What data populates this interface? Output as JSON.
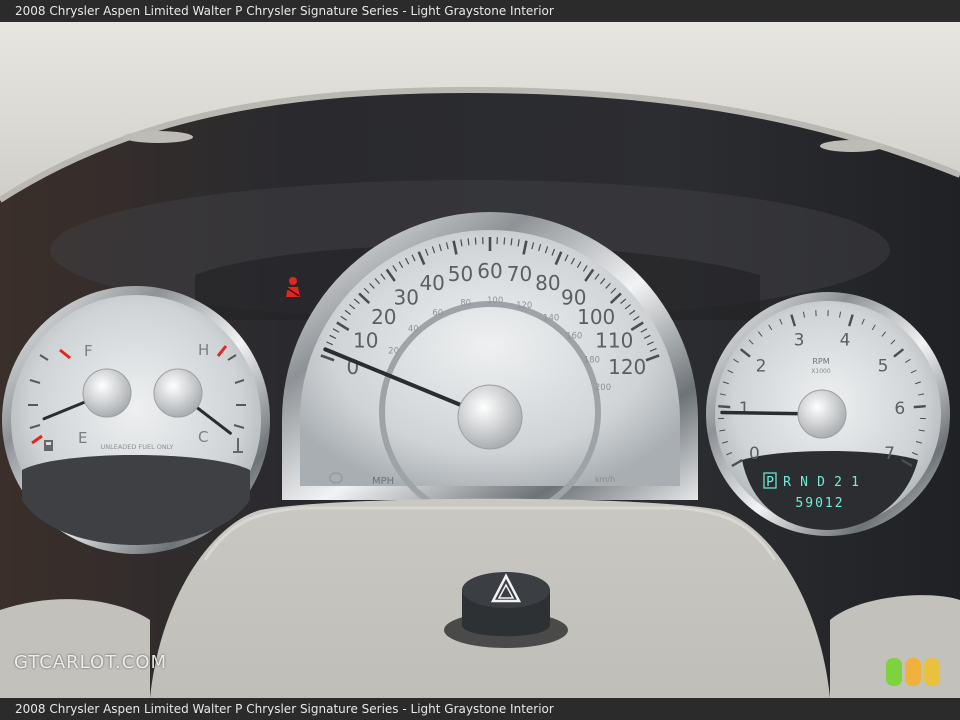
{
  "caption": {
    "top": "2008 Chrysler Aspen Limited Walter P Chrysler Signature Series - Light Graystone Interior",
    "bottom": "2008 Chrysler Aspen Limited Walter P Chrysler Signature Series - Light Graystone Interior"
  },
  "watermark": "GTCARLOT.COM",
  "rating_colors": [
    "#7ed23c",
    "#f0b23c",
    "#e8c23c"
  ],
  "speedometer": {
    "mph_labels": [
      "0",
      "10",
      "20",
      "30",
      "40",
      "50",
      "60",
      "70",
      "80",
      "90",
      "100",
      "110",
      "120"
    ],
    "kmh_labels": [
      "20",
      "40",
      "60",
      "80",
      "100",
      "120",
      "140",
      "160",
      "180",
      "200"
    ],
    "unit_mph": "MPH",
    "unit_kmh": "km/h",
    "reading_mph": 2
  },
  "tachometer": {
    "labels": [
      "0",
      "1",
      "2",
      "3",
      "4",
      "5",
      "6",
      "7"
    ],
    "unit": "RPM",
    "unit_sub": "X1000",
    "reading_krpm": 0.9
  },
  "fuel_temp_gauge": {
    "fuel_full": "F",
    "fuel_empty": "E",
    "temp_hot": "H",
    "temp_cold": "C",
    "fuel_note": "UNLEADED FUEL ONLY",
    "fuel_level": 0.05,
    "temp_level": 0.1
  },
  "gear_indicator": "PRND21",
  "selected_gear": "P",
  "odometer": "59012",
  "seatbelt_icon": "seatbelt-warning-icon",
  "hazard_icon": "hazard-triangle-icon",
  "accent_red": "#e0281e"
}
